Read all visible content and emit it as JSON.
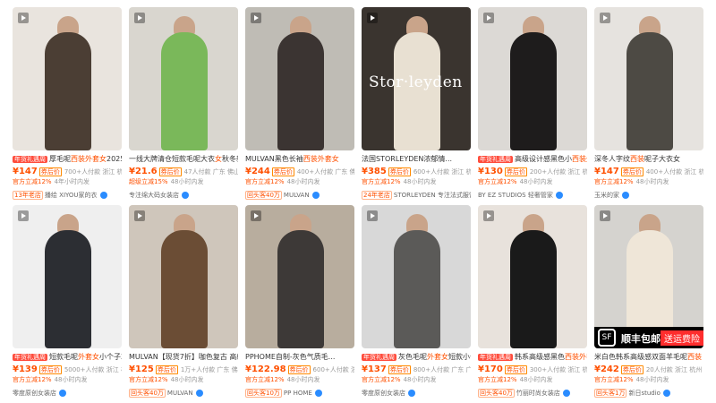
{
  "products": [
    {
      "title_tag": "年货礼遇周",
      "title_pre": "厚毛呢",
      "title_hl": "西装外套女",
      "title_post": "2025秋冬",
      "price": "¥147",
      "price_badge": "券后价",
      "sales": "700+人付款",
      "location": "浙江 杭州",
      "info_orange": "官方立减12%",
      "info_grey": "4年小时内发",
      "shop_tag": "13年老店",
      "shop": "播绘 XIYOU家的衣",
      "img_bg": "#e9e4de",
      "img_fig": "#4b3e34",
      "play": true,
      "overlay": "",
      "sf": false
    },
    {
      "title_tag": "",
      "title_pre": "一线大牌清仓短款毛呢大衣",
      "title_hl": "女",
      "title_post": "秋冬新...",
      "price": "¥21.6",
      "price_badge": "券后价",
      "sales": "47人付款",
      "location": "广东 佛山",
      "info_orange": "超级立减15%",
      "info_grey": "48小时内发",
      "shop_tag": "",
      "shop": "专注绵大码女装店",
      "img_bg": "#d9d6cf",
      "img_fig": "#7ab85a",
      "play": true,
      "overlay": "",
      "sf": false
    },
    {
      "title_tag": "",
      "title_pre": "MULVAN黑色长袖",
      "title_hl": "西装外套女",
      "title_post": "",
      "price": "¥244",
      "price_badge": "券后价",
      "sales": "400+人付款",
      "location": "广东 佛山",
      "info_orange": "官方立减12%",
      "info_grey": "48小时内发",
      "shop_tag": "回头客40万",
      "shop": "MULVAN",
      "img_bg": "#bfbcb5",
      "img_fig": "#3b3432",
      "play": true,
      "overlay": "",
      "sf": false
    },
    {
      "title_tag": "",
      "title_pre": "法国STORLEYDEN浓郁情...",
      "title_hl": "",
      "title_post": "",
      "price": "¥385",
      "price_badge": "券后价",
      "sales": "600+人付款",
      "location": "浙江 杭州",
      "info_orange": "官方立减12%",
      "info_grey": "48小时内发",
      "shop_tag": "24年老店",
      "shop": "STORLEYDEN 专注法式服饰",
      "img_bg": "#3a342f",
      "img_fig": "#e8e0d2",
      "play": true,
      "overlay": "Stor·leyden",
      "sf": false
    },
    {
      "title_tag": "年货礼遇周",
      "title_pre": "高级设计感黑色小",
      "title_hl": "西装外套女",
      "title_post": "",
      "price": "¥130",
      "price_badge": "券后价",
      "sales": "200+人付款",
      "location": "浙江 杭州",
      "info_orange": "官方立减12%",
      "info_grey": "48小时内发",
      "shop_tag": "",
      "shop": "BY EZ STUDIOS 轻奢管家",
      "img_bg": "#dcd9d5",
      "img_fig": "#1e1c1c",
      "play": true,
      "overlay": "",
      "sf": false
    },
    {
      "title_tag": "",
      "title_pre": "深冬人字纹",
      "title_hl": "西装",
      "title_post": "呢子大衣女",
      "price": "¥147",
      "price_badge": "券后价",
      "sales": "400+人付款",
      "location": "浙江 杭州",
      "info_orange": "官方立减12%",
      "info_grey": "48小时内发",
      "shop_tag": "",
      "shop": "玉米的家",
      "img_bg": "#e6e3df",
      "img_fig": "#4d4a44",
      "play": true,
      "overlay": "",
      "sf": false
    },
    {
      "title_tag": "年货礼遇周",
      "title_pre": "短款毛呢",
      "title_hl": "外套女",
      "title_post": "小个子2025...",
      "price": "¥139",
      "price_badge": "券后价",
      "sales": "5000+人付款",
      "location": "浙江 杭州",
      "info_orange": "官方立减12%",
      "info_grey": "48小时内发",
      "shop_tag": "",
      "shop": "零度原创女装店",
      "img_bg": "#efefef",
      "img_fig": "#2c2e33",
      "play": true,
      "overlay": "",
      "sf": false
    },
    {
      "title_tag": "",
      "title_pre": "MULVAN【现货7折】咖色",
      "title_hl": "",
      "title_post": "复古 高级...",
      "price": "¥125",
      "price_badge": "券后价",
      "sales": "1万+人付款",
      "location": "广东 佛山",
      "info_orange": "官方立减12%",
      "info_grey": "48小时内发",
      "shop_tag": "回头客40万",
      "shop": "MULVAN",
      "img_bg": "#cfc6bb",
      "img_fig": "#6b4d35",
      "play": true,
      "overlay": "",
      "sf": false
    },
    {
      "title_tag": "",
      "title_pre": "PPHOME自制-灰色气质毛...",
      "title_hl": "",
      "title_post": "",
      "price": "¥122.98",
      "price_badge": "券后价",
      "sales": "600+人付款",
      "location": "浙江 杭州",
      "info_orange": "官方立减12%",
      "info_grey": "48小时内发",
      "shop_tag": "回头客10万",
      "shop": "PP HOME",
      "img_bg": "#b8ad9e",
      "img_fig": "#3d3937",
      "play": true,
      "overlay": "",
      "sf": false
    },
    {
      "title_tag": "年货礼遇周",
      "title_pre": "灰色毛呢",
      "title_hl": "外套女",
      "title_post": "短款小个子...",
      "price": "¥137",
      "price_badge": "券后价",
      "sales": "800+人付款",
      "location": "广东 广州",
      "info_orange": "官方立减12%",
      "info_grey": "48小时内发",
      "shop_tag": "",
      "shop": "零度原创女装店",
      "img_bg": "#d8d8d8",
      "img_fig": "#5b5a58",
      "play": true,
      "overlay": "",
      "sf": false
    },
    {
      "title_tag": "年货礼遇周",
      "title_pre": "韩系高级感黑色",
      "title_hl": "西装外套女",
      "title_post": "",
      "price": "¥170",
      "price_badge": "券后价",
      "sales": "300+人付款",
      "location": "浙江 杭州",
      "info_orange": "官方立减12%",
      "info_grey": "48小时内发",
      "shop_tag": "回头客40万",
      "shop": "竹丽时尚女装店",
      "img_bg": "#e8e2dc",
      "img_fig": "#1a1a1a",
      "play": true,
      "overlay": "",
      "sf": false
    },
    {
      "title_tag": "",
      "title_pre": "米白色韩系高级感双面羊毛呢",
      "title_hl": "西装",
      "title_post": "",
      "price": "¥242",
      "price_badge": "券后价",
      "sales": "20人付款",
      "location": "浙江 杭州",
      "info_orange": "官方立减12%",
      "info_grey": "48小时内发",
      "shop_tag": "回头客1万",
      "shop": "新日studio",
      "img_bg": "#d5d3cf",
      "img_fig": "#efe6d8",
      "play": true,
      "overlay": "",
      "sf": true,
      "sf_logo": "SF",
      "sf_text": "顺丰包邮",
      "sf_gift": "送运费险"
    }
  ]
}
